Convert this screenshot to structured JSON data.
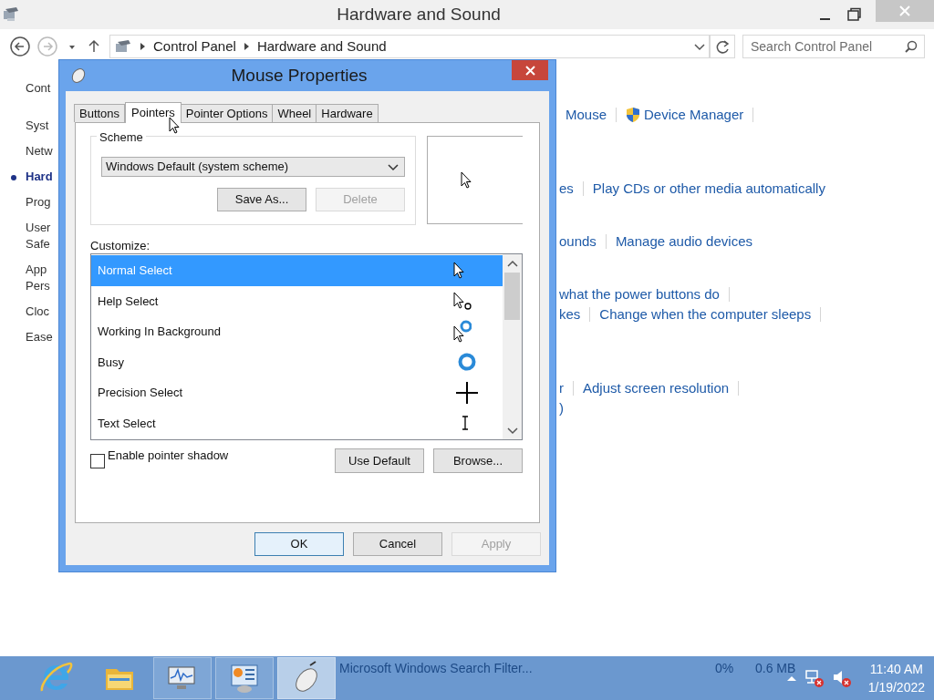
{
  "window": {
    "title": "Hardware and Sound"
  },
  "address": {
    "segments": [
      "Control Panel",
      "Hardware and Sound"
    ]
  },
  "search": {
    "placeholder": "Search Control Panel"
  },
  "sidebar": {
    "items": [
      {
        "label": "Cont",
        "selected": false
      },
      {
        "label": "Syst",
        "selected": false
      },
      {
        "label": "Netw",
        "selected": false
      },
      {
        "label": "Hard",
        "selected": true
      },
      {
        "label": "Prog",
        "selected": false
      },
      {
        "label": "User",
        "selected": false
      },
      {
        "label": "Safe",
        "selected": false
      },
      {
        "label": "App",
        "selected": false
      },
      {
        "label": "Pers",
        "selected": false
      },
      {
        "label": "Cloc",
        "selected": false
      },
      {
        "label": "Ease",
        "selected": false
      }
    ]
  },
  "link_rows": [
    {
      "links": [
        {
          "text": "Mouse"
        },
        {
          "text": "Device Manager",
          "shield": true
        }
      ],
      "trailing_separator": true
    },
    {
      "links": [
        {
          "text": "es"
        },
        {
          "text": "Play CDs or other media automatically"
        }
      ],
      "trailing_separator": false
    },
    {
      "links": [
        {
          "text": "ounds"
        },
        {
          "text": "Manage audio devices"
        }
      ],
      "trailing_separator": false
    },
    {
      "links": [
        {
          "text": "what the power buttons do"
        }
      ],
      "trailing_separator": true
    },
    {
      "links": [
        {
          "text": "kes"
        },
        {
          "text": "Change when the computer sleeps"
        }
      ],
      "trailing_separator": true
    },
    {
      "links": [
        {
          "text": "r"
        },
        {
          "text": "Adjust screen resolution"
        }
      ],
      "trailing_separator": true
    },
    {
      "links": [
        {
          "text": ")"
        }
      ],
      "trailing_separator": false
    }
  ],
  "dialog": {
    "title": "Mouse Properties",
    "tabs": [
      {
        "label": "Buttons",
        "selected": false
      },
      {
        "label": "Pointers",
        "selected": true
      },
      {
        "label": "Pointer Options",
        "selected": false
      },
      {
        "label": "Wheel",
        "selected": false
      },
      {
        "label": "Hardware",
        "selected": false
      }
    ],
    "scheme": {
      "label": "Scheme",
      "value": "Windows Default (system scheme)",
      "buttons": [
        {
          "label": "Save As...",
          "disabled": false
        },
        {
          "label": "Delete",
          "disabled": true
        }
      ]
    },
    "customize": {
      "label": "Customize:",
      "items": [
        {
          "label": "Normal Select",
          "kind": "normal",
          "selected": true
        },
        {
          "label": "Help Select",
          "kind": "help",
          "selected": false
        },
        {
          "label": "Working In Background",
          "kind": "working",
          "selected": false
        },
        {
          "label": "Busy",
          "kind": "busy",
          "selected": false
        },
        {
          "label": "Precision Select",
          "kind": "precision",
          "selected": false
        },
        {
          "label": "Text Select",
          "kind": "text",
          "selected": false
        }
      ]
    },
    "shadow_checkbox": {
      "label": "Enable pointer shadow",
      "checked": false
    },
    "list_buttons": [
      "Use Default",
      "Browse..."
    ],
    "footer_buttons": [
      {
        "label": "OK",
        "default": true,
        "disabled": false
      },
      {
        "label": "Cancel",
        "default": false,
        "disabled": false
      },
      {
        "label": "Apply",
        "default": false,
        "disabled": true
      }
    ]
  },
  "taskbar": {
    "apps": [
      {
        "kind": "browser",
        "active": false
      },
      {
        "kind": "folder",
        "active": false
      },
      {
        "kind": "monitor",
        "active": false
      },
      {
        "kind": "control-panel",
        "active": false
      },
      {
        "kind": "mouse",
        "active": true
      }
    ],
    "ghost_row": {
      "name": "Microsoft Windows Search Filter...",
      "cpu": "0%",
      "memory": "0.6 MB"
    },
    "time": "11:40 AM",
    "date": "1/19/2022"
  }
}
